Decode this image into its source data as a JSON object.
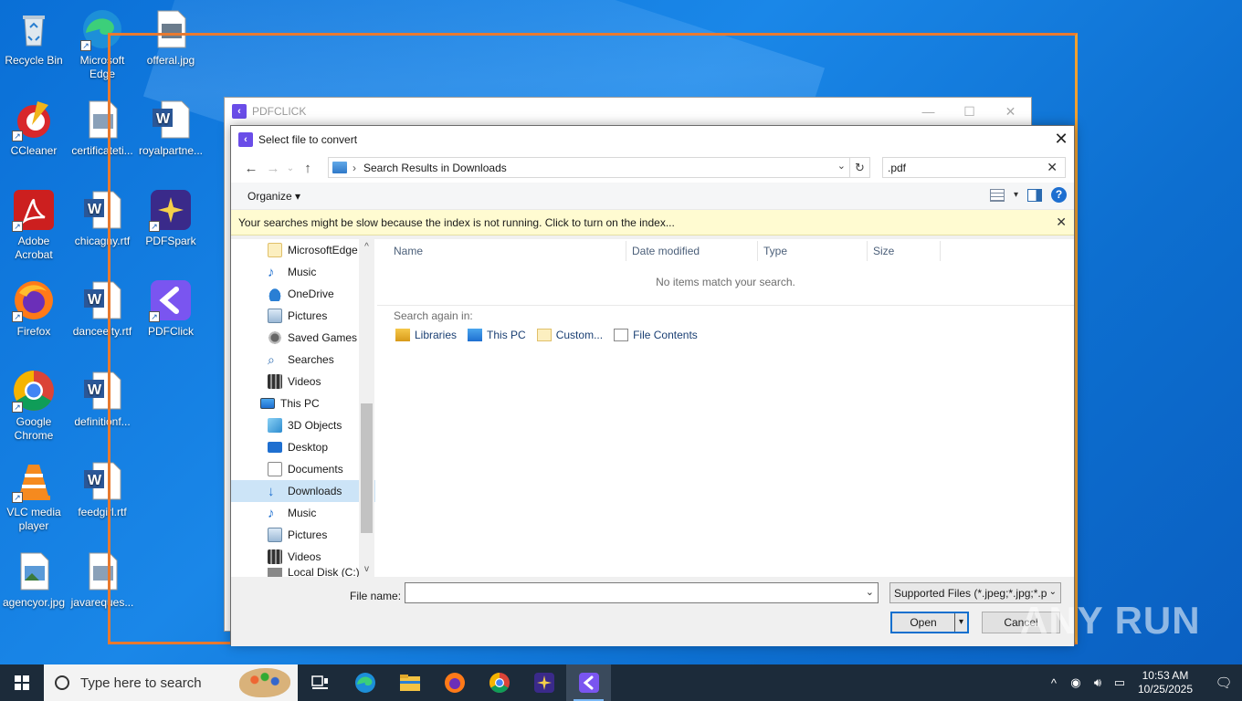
{
  "desktop_icons": [
    {
      "label": "Recycle Bin"
    },
    {
      "label": "Microsoft Edge"
    },
    {
      "label": "offeral.jpg"
    },
    {
      "label": "CCleaner"
    },
    {
      "label": "certificateti..."
    },
    {
      "label": "royalpartne..."
    },
    {
      "label": "Adobe Acrobat"
    },
    {
      "label": "chicagny.rtf"
    },
    {
      "label": "PDFSpark"
    },
    {
      "label": "Firefox"
    },
    {
      "label": "danceeity.rtf"
    },
    {
      "label": "PDFClick"
    },
    {
      "label": "Google Chrome"
    },
    {
      "label": "definitionf..."
    },
    {
      "label": "VLC media player"
    },
    {
      "label": "feedgirl.rtf"
    },
    {
      "label": "agencyor.jpg"
    },
    {
      "label": "javareques..."
    }
  ],
  "app_window": {
    "title": "PDFCLICK"
  },
  "dialog": {
    "title": "Select file to convert",
    "address": {
      "path": "Search Results in Downloads"
    },
    "search": {
      "value": ".pdf"
    },
    "toolbar": {
      "organize_label": "Organize"
    },
    "infobar": {
      "text": "Your searches might be slow because the index is not running.  Click to turn on the index..."
    },
    "nav_items": [
      {
        "label": "MicrosoftEdge"
      },
      {
        "label": "Music"
      },
      {
        "label": "OneDrive"
      },
      {
        "label": "Pictures"
      },
      {
        "label": "Saved Games"
      },
      {
        "label": "Searches"
      },
      {
        "label": "Videos"
      },
      {
        "label": "This PC"
      },
      {
        "label": "3D Objects"
      },
      {
        "label": "Desktop"
      },
      {
        "label": "Documents"
      },
      {
        "label": "Downloads"
      },
      {
        "label": "Music"
      },
      {
        "label": "Pictures"
      },
      {
        "label": "Videos"
      },
      {
        "label": "Local Disk (C:)"
      }
    ],
    "columns": {
      "name": "Name",
      "date_modified": "Date modified",
      "type": "Type",
      "size": "Size"
    },
    "empty_message": "No items match your search.",
    "search_again_label": "Search again in:",
    "search_again_links": {
      "libraries": "Libraries",
      "this_pc": "This PC",
      "custom": "Custom...",
      "file_contents": "File Contents"
    },
    "file_name_label": "File name:",
    "file_name_value": "",
    "filter_value": "Supported Files (*.jpeg;*.jpg;*.p",
    "open_label": "Open",
    "cancel_label": "Cancel"
  },
  "watermark": "ANY RUN",
  "taskbar": {
    "search_placeholder": "Type here to search",
    "time": "10:53 AM",
    "date": "10/25/2025"
  },
  "colors": {
    "accent": "#0078d7",
    "highlight_border": "#e8792e",
    "taskbar": "#1c2b3a",
    "infobar": "#fffbd1"
  }
}
